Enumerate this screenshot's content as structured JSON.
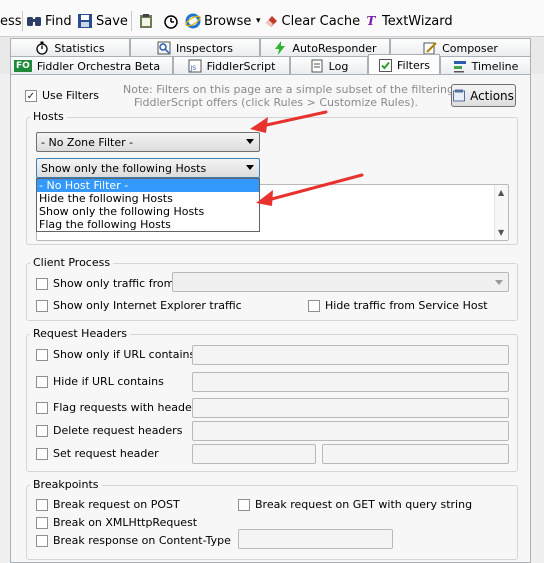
{
  "toolbar": {
    "items": [
      {
        "label": "ess"
      },
      {
        "label": "Find",
        "icon": "binoculars-icon"
      },
      {
        "label": "Save",
        "icon": "save-icon"
      },
      {
        "label": "",
        "icon": "clipboard-icon"
      },
      {
        "label": "",
        "icon": "timer-icon"
      },
      {
        "label": "Browse",
        "icon": "ie-icon"
      },
      {
        "label": "Clear Cache",
        "icon": "eraser-icon"
      },
      {
        "label": "TextWizard",
        "icon": "textwizard-icon"
      }
    ]
  },
  "tabs": {
    "row1": [
      {
        "label": "Statistics"
      },
      {
        "label": "Inspectors"
      },
      {
        "label": "AutoResponder"
      },
      {
        "label": "Composer"
      }
    ],
    "row2": [
      {
        "label": "Fiddler Orchestra Beta",
        "badge": "FO"
      },
      {
        "label": "FiddlerScript"
      },
      {
        "label": "Log"
      },
      {
        "label": "Filters"
      },
      {
        "label": "Timeline"
      }
    ]
  },
  "filters": {
    "use_filters_label": "Use Filters",
    "use_filters_checked": true,
    "note_line1": "Note: Filters on this page are a simple subset of the filtering",
    "note_line2": "FiddlerScript offers (click Rules > Customize Rules).",
    "actions_label": "Actions"
  },
  "hosts": {
    "title": "Hosts",
    "zone_filter_value": "- No Zone Filter -",
    "host_filter_value": "Show only the following Hosts",
    "options": [
      "- No Host Filter -",
      "Hide the following Hosts",
      "Show only the following Hosts",
      "Flag the following Hosts"
    ],
    "highlighted_index": 0
  },
  "client_process": {
    "title": "Client Process",
    "show_only_traffic_from": "Show only traffic from",
    "show_only_ie": "Show only Internet Explorer traffic",
    "hide_service_host": "Hide traffic from Service Host"
  },
  "request_headers": {
    "title": "Request Headers",
    "show_only_url": "Show only if URL contains",
    "hide_if_url": "Hide if URL contains",
    "flag_requests": "Flag requests with headers",
    "delete_headers": "Delete request headers",
    "set_header": "Set request header"
  },
  "breakpoints": {
    "title": "Breakpoints",
    "break_post": "Break request on POST",
    "break_get": "Break request on GET with query string",
    "break_xhr": "Break on XMLHttpRequest",
    "break_response": "Break response on Content-Type"
  },
  "colors": {
    "annotation_arrow": "#e8322e",
    "dropdown_highlight": "#3399ff"
  }
}
